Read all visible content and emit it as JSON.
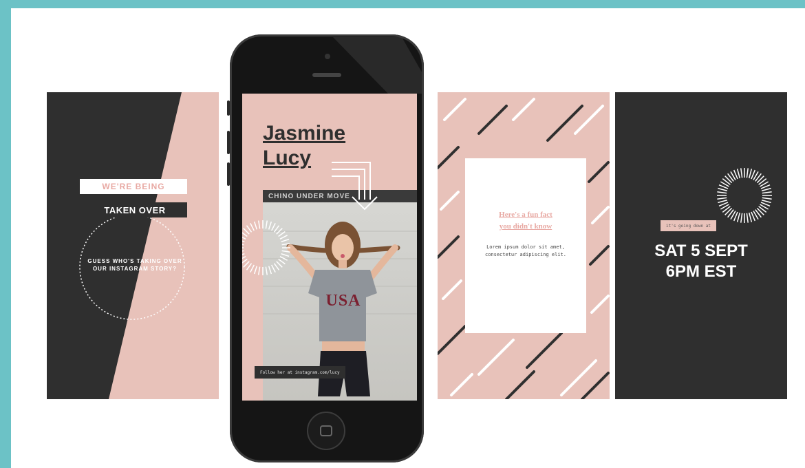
{
  "colors": {
    "frame": "#6cc2c6",
    "dark": "#2f2f2f",
    "blush": "#e8c2ba",
    "accent_pink": "#e8a9a3",
    "white": "#ffffff"
  },
  "card1": {
    "label_1": "WE'RE BEING",
    "label_2": "TAKEN OVER",
    "body": "GUESS WHO'S TAKING OVER OUR INSTAGRAM STORY?"
  },
  "phone": {
    "title_line_1": "Jasmine",
    "title_line_2": "Lucy",
    "shirt_text": "USA",
    "sign_text": "CHINO UNDER MOVE",
    "caption": "Follow her at instagram.com/lucy"
  },
  "card3": {
    "title_line_1": "Here's a fun fact",
    "title_line_2": "you didn't know",
    "body": "Lorem ipsum dolor sit amet, consectetur adipiscing elit."
  },
  "card4": {
    "tag": "it's going down at",
    "date_line_1": "SAT 5 SEPT",
    "date_line_2": "6PM EST"
  },
  "icons": {
    "sunburst": "sunburst-icon",
    "chevron_arrows": "chevron-arrow-icon",
    "dashed_circle": "dashed-circle-icon",
    "home_button": "home-button-icon"
  }
}
